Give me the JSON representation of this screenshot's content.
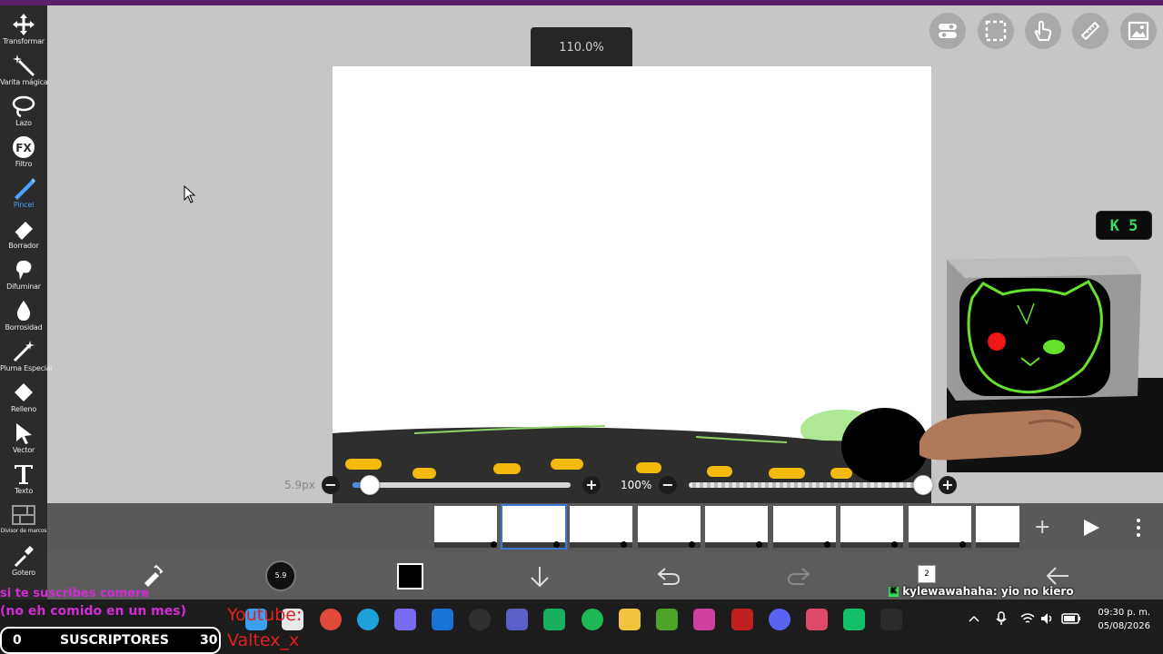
{
  "tools": [
    {
      "name": "transform",
      "label": "Transformar",
      "icon": "move-arrows-icon"
    },
    {
      "name": "magic-wand",
      "label": "Varita mágica",
      "icon": "magic-wand-icon"
    },
    {
      "name": "lasso",
      "label": "Lazo",
      "icon": "lasso-icon"
    },
    {
      "name": "filter",
      "label": "Filtro",
      "icon": "fx-icon"
    },
    {
      "name": "brush",
      "label": "Pincel",
      "icon": "brush-icon",
      "active": true
    },
    {
      "name": "eraser",
      "label": "Borrador",
      "icon": "eraser-icon"
    },
    {
      "name": "blur",
      "label": "Difuminar",
      "icon": "smudge-icon"
    },
    {
      "name": "blurriness",
      "label": "Borrosidad",
      "icon": "droplet-icon"
    },
    {
      "name": "special-pen",
      "label": "Pluma Especial",
      "icon": "special-pen-icon"
    },
    {
      "name": "fill",
      "label": "Relleno",
      "icon": "fill-bucket-icon"
    },
    {
      "name": "vector",
      "label": "Vector",
      "icon": "vector-arrow-icon"
    },
    {
      "name": "text",
      "label": "Texto",
      "icon": "text-icon"
    },
    {
      "name": "frame-divider",
      "label": "Divisor de marcos",
      "icon": "frame-divider-icon"
    },
    {
      "name": "eyedropper",
      "label": "Gotero",
      "icon": "eyedropper-icon"
    }
  ],
  "zoom_label": "110.0%",
  "brush_size_label": "5.9px",
  "brush_size_value": 0.08,
  "opacity_label": "100%",
  "opacity_value": 1.0,
  "brush_preview_label": "5.9",
  "frame_count_badge": "2",
  "counter_badge": "K 5",
  "overlay": {
    "pink_line1": "si te suscribes comere",
    "pink_line2": "(no eh comido en un mes)",
    "red_line1": "Youtube:",
    "red_line2": "Valtex_x",
    "subs_left": "0",
    "subs_label": "SUSCRIPTORES",
    "subs_right": "30",
    "chat_user": "kylewawahaha",
    "chat_message": ": yio no kiero"
  },
  "clock": {
    "time": "09:30 p. m.",
    "date": "05/08/2026"
  },
  "colors": {
    "accent": "#3a78d0",
    "toolbar": "#2b2b2b",
    "overlay_pink": "#d12bd3",
    "overlay_red": "#e02020",
    "counter_green": "#3bdc5b"
  }
}
